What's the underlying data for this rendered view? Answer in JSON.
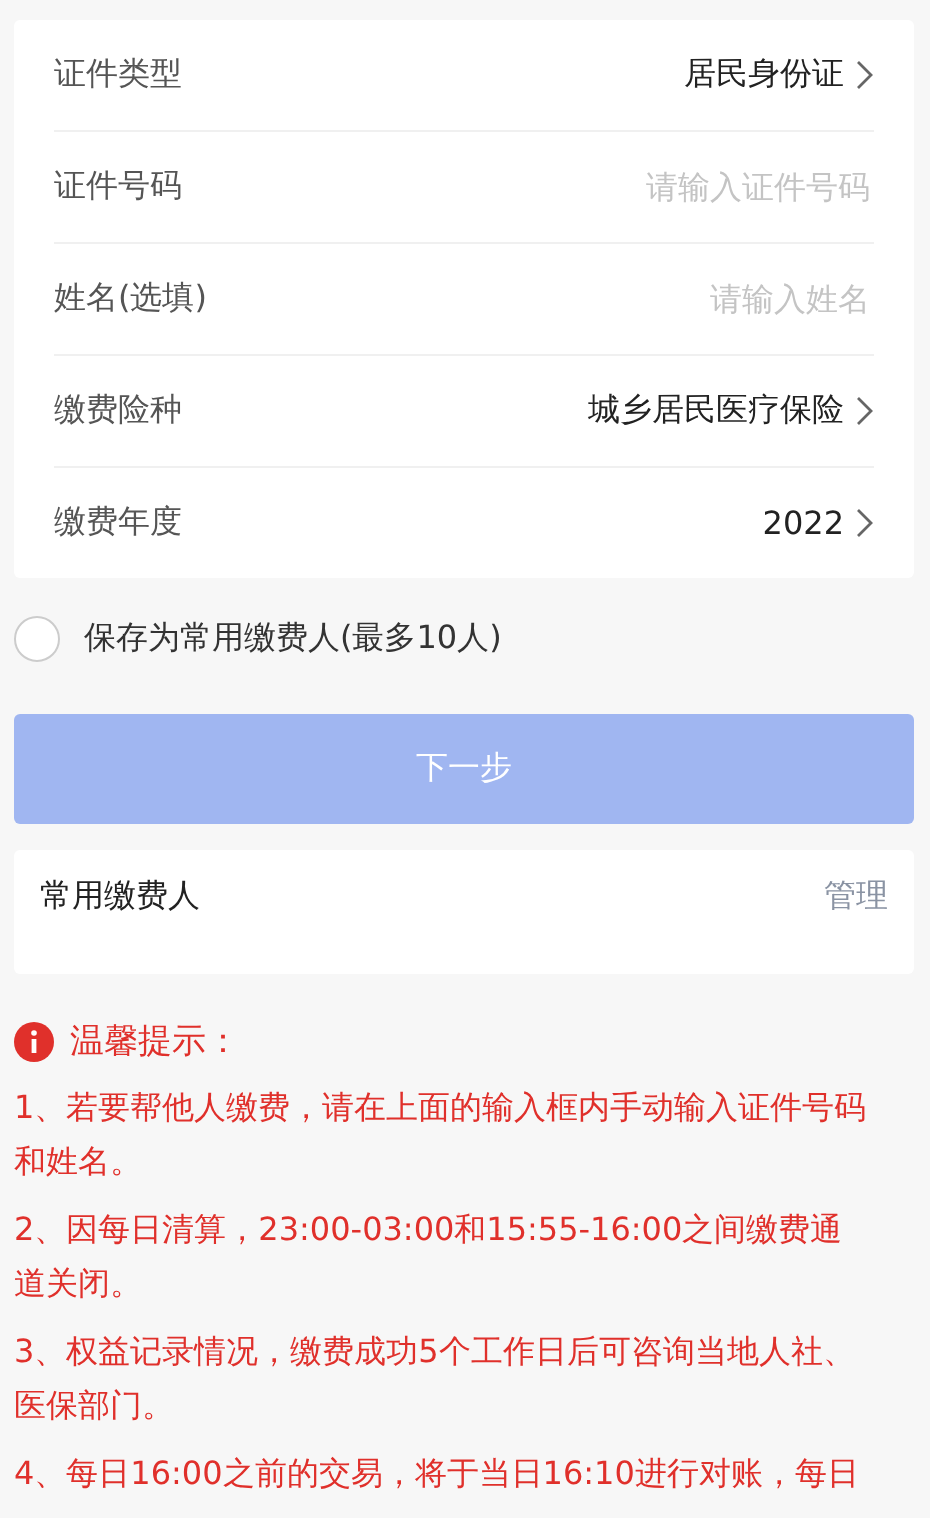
{
  "form": {
    "rows": [
      {
        "kind": "select",
        "label": "证件类型",
        "value": "居民身份证"
      },
      {
        "kind": "input",
        "label": "证件号码",
        "placeholder": "请输入证件号码"
      },
      {
        "kind": "input",
        "label": "姓名(选填)",
        "placeholder": "请输入姓名"
      },
      {
        "kind": "select",
        "label": "缴费险种",
        "value": "城乡居民医疗保险"
      },
      {
        "kind": "select",
        "label": "缴费年度",
        "value": "2022"
      }
    ]
  },
  "save_payer": {
    "label": "保存为常用缴费人(最多10人)",
    "checked": false
  },
  "next_button": {
    "label": "下一步",
    "disabled": true
  },
  "frequent_payers": {
    "title": "常用缴费人",
    "action": "管理"
  },
  "tips": {
    "title": "温馨提示：",
    "items": [
      "1、若要帮他人缴费，请在上面的输入框内手动输入证件号码和姓名。",
      "2、因每日清算，23:00-03:00和15:55-16:00之间缴费通道关闭。",
      "3、权益记录情况，缴费成功5个工作日后可咨询当地人社、医保部门。",
      "4、每日16:00之前的交易，将于当日16:10进行对账，每日"
    ]
  }
}
